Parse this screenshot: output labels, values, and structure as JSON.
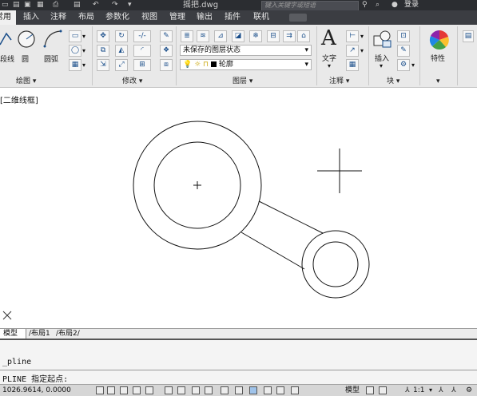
{
  "titlebar": {
    "doc_title": "摇把.dwg",
    "search_placeholder": "键入关键字或短语",
    "signin": "登录"
  },
  "tabs": [
    {
      "label": "常用",
      "active": true
    },
    {
      "label": "插入"
    },
    {
      "label": "注释"
    },
    {
      "label": "布局"
    },
    {
      "label": "参数化"
    },
    {
      "label": "视图"
    },
    {
      "label": "管理"
    },
    {
      "label": "输出"
    },
    {
      "label": "插件"
    },
    {
      "label": "联机"
    }
  ],
  "ribbon": {
    "draw": {
      "polyline": "段线",
      "circle": "圆",
      "arc": "圆弧",
      "panel_label": "绘图 ▾"
    },
    "modify": {
      "panel_label": "修改 ▾"
    },
    "layers": {
      "layer_state": "未保存的图层状态",
      "current_layer": "轮廓",
      "panel_label": "图层 ▾"
    },
    "annotation": {
      "text": "文字",
      "panel_label": "注释 ▾"
    },
    "block": {
      "insert": "插入",
      "panel_label": "块 ▾"
    },
    "properties": {
      "label": "特性"
    }
  },
  "viewport": {
    "label": "[二维线框]"
  },
  "layout_tabs": [
    "模型",
    "布局1",
    "布局2"
  ],
  "command": {
    "history": "_pline",
    "prompt": "PLINE 指定起点:"
  },
  "status": {
    "coords": "1026.9614, 0.0000",
    "model": "模型",
    "scale": "1:1"
  },
  "colors": {
    "titlebar": "#2b2d31",
    "tabbar": "#3b3d42",
    "ribbon": "#e9e9e9",
    "canvas": "#ffffff",
    "accent_blue": "#1a4e8a"
  }
}
